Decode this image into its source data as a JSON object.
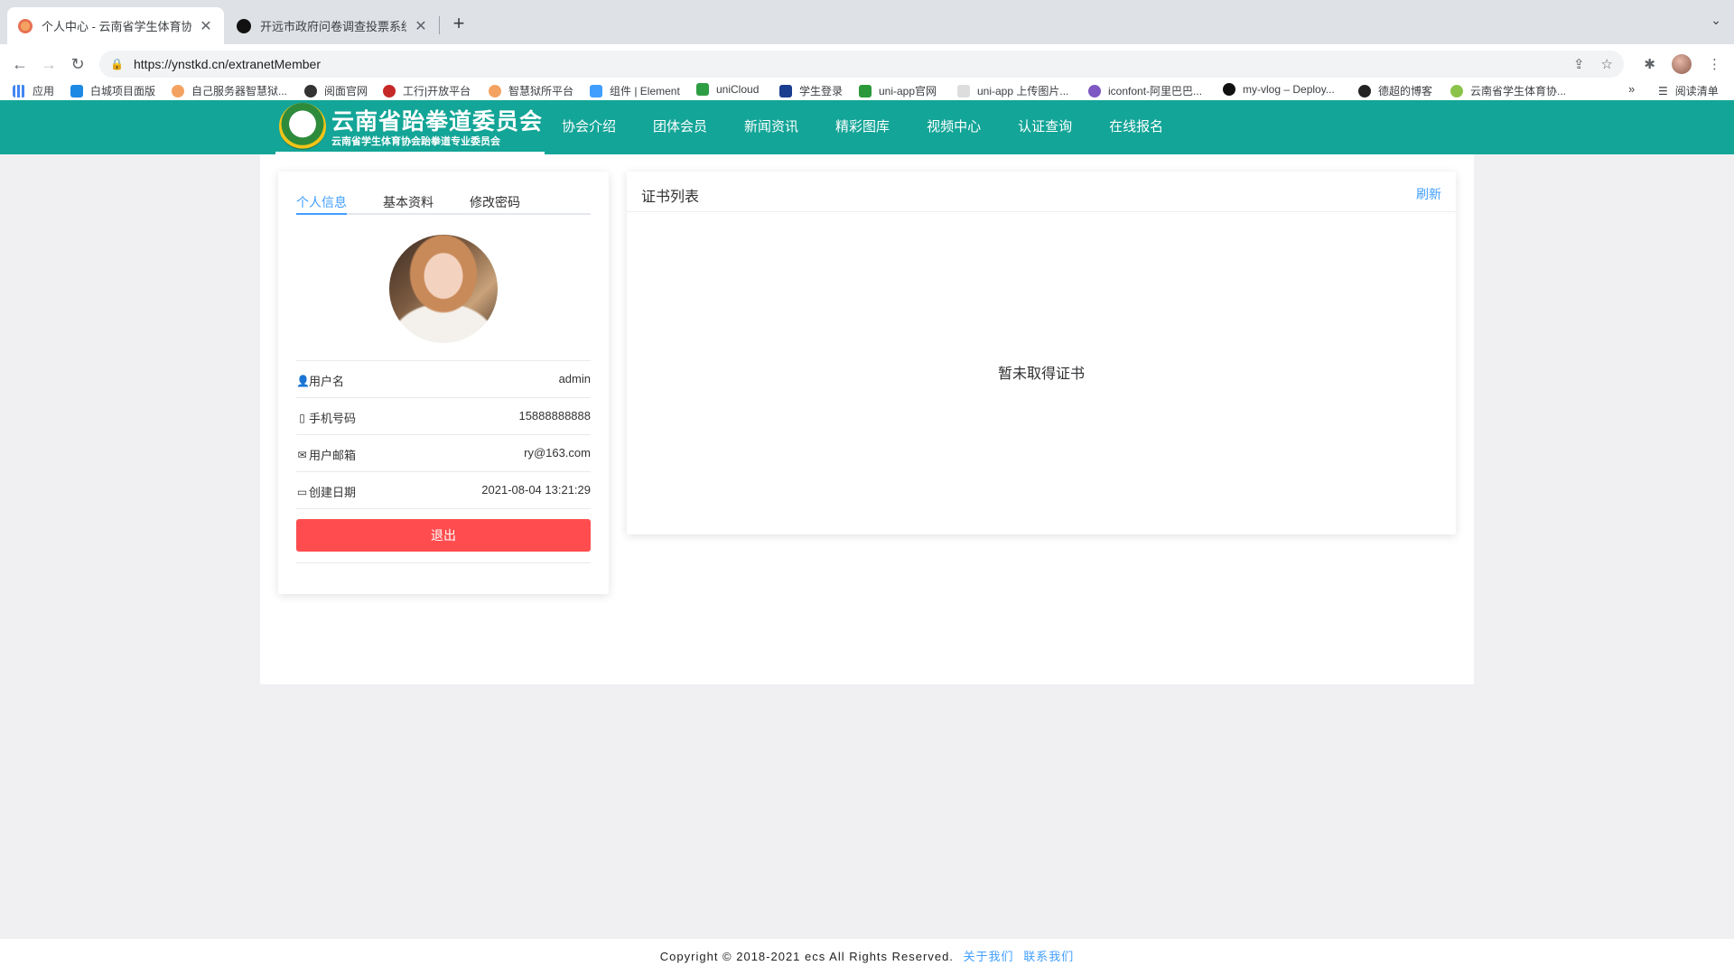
{
  "browser": {
    "tabs": [
      {
        "title": "个人中心 - 云南省学生体育协会",
        "active": true
      },
      {
        "title": "开远市政府问卷调查投票系统 | 新",
        "active": false
      }
    ],
    "url": "https://ynstkd.cn/extranetMember",
    "bookmarks": [
      {
        "label": "应用",
        "icon": "apps-grid-icon",
        "color": "#4285f4"
      },
      {
        "label": "白城项目面版",
        "icon": "bookmark-icon",
        "color": "#1e88e5"
      },
      {
        "label": "自己服务器智慧狱...",
        "icon": "bookmark-icon",
        "color": "#f4a261"
      },
      {
        "label": "阅面官网",
        "icon": "bookmark-icon",
        "color": "#333333"
      },
      {
        "label": "工行|开放平台",
        "icon": "bookmark-icon",
        "color": "#c62828"
      },
      {
        "label": "智慧狱所平台",
        "icon": "bookmark-icon",
        "color": "#f4a261"
      },
      {
        "label": "组件 | Element",
        "icon": "bookmark-icon",
        "color": "#409eff"
      },
      {
        "label": "uniCloud",
        "icon": "bookmark-icon",
        "color": "#2e9e44"
      },
      {
        "label": "学生登录",
        "icon": "bookmark-icon",
        "color": "#1a3d8f"
      },
      {
        "label": "uni-app官网",
        "icon": "bookmark-icon",
        "color": "#2b9939"
      },
      {
        "label": "uni-app 上传图片...",
        "icon": "bookmark-icon",
        "color": "#dddddd"
      },
      {
        "label": "iconfont-阿里巴巴...",
        "icon": "bookmark-icon",
        "color": "#7e57c2"
      },
      {
        "label": "my-vlog – Deploy...",
        "icon": "bookmark-icon",
        "color": "#111111"
      },
      {
        "label": "德超的博客",
        "icon": "bookmark-icon",
        "color": "#222222"
      },
      {
        "label": "云南省学生体育协...",
        "icon": "bookmark-icon",
        "color": "#8bc34a"
      }
    ],
    "reading_list": "阅读清单"
  },
  "site": {
    "logo_title": "云南省跆拳道委员会",
    "logo_subtitle": "云南省学生体育协会跆拳道专业委员会",
    "nav": [
      "协会介绍",
      "团体会员",
      "新闻资讯",
      "精彩图库",
      "视频中心",
      "认证查询",
      "在线报名"
    ],
    "brand_color": "#13a597"
  },
  "profile": {
    "tabs": [
      "个人信息",
      "基本资料",
      "修改密码"
    ],
    "active_tab": "个人信息",
    "rows": [
      {
        "icon": "user-icon",
        "label": "用户名",
        "value": "admin"
      },
      {
        "icon": "phone-icon",
        "label": "手机号码",
        "value": "15888888888"
      },
      {
        "icon": "mail-icon",
        "label": "用户邮箱",
        "value": "ry@163.com"
      },
      {
        "icon": "calendar-icon",
        "label": "创建日期",
        "value": "2021-08-04 13:21:29"
      }
    ],
    "logout_label": "退出"
  },
  "certificates": {
    "title": "证书列表",
    "refresh_label": "刷新",
    "empty_text": "暂未取得证书"
  },
  "footer": {
    "copyright": "Copyright © 2018-2021 ecs All Rights Reserved.",
    "links": [
      "关于我们",
      "联系我们"
    ]
  }
}
